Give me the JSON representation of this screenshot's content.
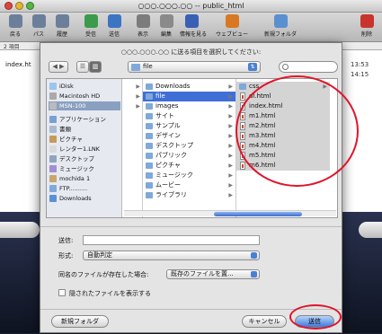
{
  "window": {
    "title": "○○○.○○○.○○  --  public_html"
  },
  "toolbar": {
    "items": [
      {
        "label": "戻る",
        "icon": "back-icon"
      },
      {
        "label": "パス",
        "icon": "path-icon"
      },
      {
        "label": "履歴",
        "icon": "history-icon"
      },
      {
        "label": "受信",
        "icon": "download-icon"
      },
      {
        "label": "送信",
        "icon": "upload-icon"
      },
      {
        "label": "表示",
        "icon": "view-icon"
      },
      {
        "label": "編集",
        "icon": "edit-icon"
      },
      {
        "label": "情報を見る",
        "icon": "info-icon"
      },
      {
        "label": "ウェブビュー",
        "icon": "firefox-icon"
      },
      {
        "label": "新規フォルダ",
        "icon": "new-folder-icon"
      },
      {
        "label": "削除",
        "icon": "delete-icon"
      }
    ]
  },
  "background_list": {
    "status": "2 項目",
    "rows": [
      {
        "name": "index.ht",
        "time": "13:53"
      },
      {
        "name": "",
        "time": "14:15"
      }
    ]
  },
  "dialog": {
    "prompt": "○○○.○○○.○○ に送る項目を選択してください:",
    "path_popup": "file",
    "sidebar": [
      {
        "label": "iDisk",
        "icon": "idisk-icon"
      },
      {
        "label": "Macintosh HD",
        "icon": "hard-disk-icon"
      },
      {
        "label": "MSN-100",
        "icon": "disk-icon"
      },
      {
        "label": "アプリケーション",
        "icon": "applications-icon"
      },
      {
        "label": "書類",
        "icon": "documents-icon"
      },
      {
        "label": "ピクチャ",
        "icon": "pictures-icon"
      },
      {
        "label": "レンター1.LNK",
        "icon": "link-icon"
      },
      {
        "label": "デスクトップ",
        "icon": "desktop-icon"
      },
      {
        "label": "ミュージック",
        "icon": "music-icon"
      },
      {
        "label": "mochida 1",
        "icon": "home-icon"
      },
      {
        "label": "FTP..........",
        "icon": "folder-icon"
      },
      {
        "label": "Downloads",
        "icon": "downloads-icon"
      }
    ],
    "column1": [
      "",
      "",
      ""
    ],
    "column2": [
      "Downloads",
      "file",
      "images",
      "サイト",
      "サンプル",
      "デザイン",
      "デスクトップ",
      "パブリック",
      "ピクチャ",
      "ミュージック",
      "ムービー",
      "ライブラリ"
    ],
    "column3": [
      "css",
      "dl.html",
      "index.html",
      "m1.html",
      "m2.html",
      "m3.html",
      "m4.html",
      "m5.html",
      "m6.html"
    ],
    "form": {
      "name_label": "送信:",
      "name_value": "",
      "format_label": "形式:",
      "format_value": "自動判定",
      "conflict_label": "同名のファイルが存在した場合:",
      "conflict_value": "既存のファイルを置...",
      "hidden_label": "隠されたファイルを表示する"
    },
    "buttons": {
      "new_folder": "新規フォルダ",
      "cancel": "キャンセル",
      "send": "送信"
    }
  },
  "colors": {
    "annotation": "#e0142b",
    "selection": "#3f6fd6",
    "accent": "#3b7bdd"
  }
}
